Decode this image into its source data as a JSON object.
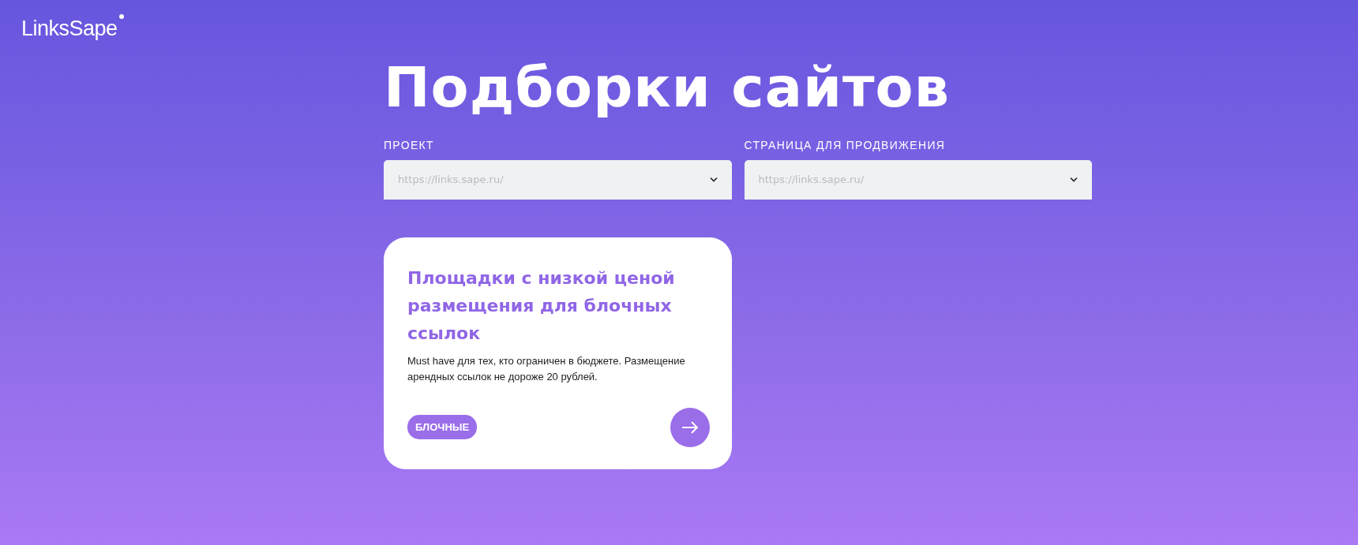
{
  "logo": {
    "text": "LinksSape"
  },
  "title": "Подборки сайтов",
  "filters": [
    {
      "label": "ПРОЕКТ",
      "value": "https://links.sape.ru/"
    },
    {
      "label": "СТРАНИЦА ДЛЯ ПРОДВИЖЕНИЯ",
      "value": "https://links.sape.ru/"
    }
  ],
  "cards": [
    {
      "title": "Площадки с низкой ценой размещения для блочных ссылок",
      "description": "Must have для тех, кто ограничен в бюджете. Размещение арендных ссылок не дороже 20 рублей.",
      "tag": "БЛОЧНЫЕ"
    }
  ]
}
